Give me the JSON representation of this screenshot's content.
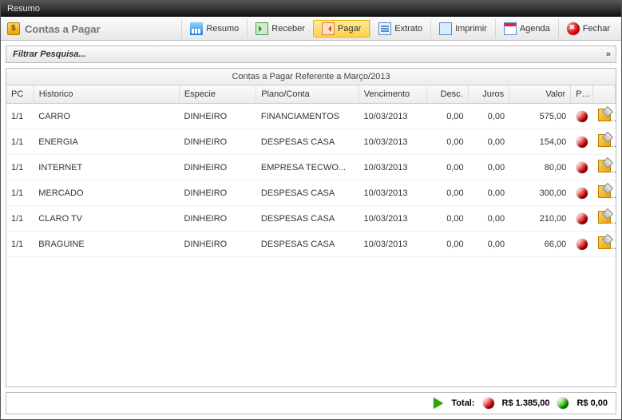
{
  "window": {
    "title": "Resumo"
  },
  "section": {
    "title": "Contas a Pagar"
  },
  "toolbar": {
    "resumo": "Resumo",
    "receber": "Receber",
    "pagar": "Pagar",
    "extrato": "Extrato",
    "imprimir": "Imprimir",
    "agenda": "Agenda",
    "fechar": "Fechar",
    "active": "pagar"
  },
  "filter": {
    "label": "Filtrar Pesquisa..."
  },
  "grid": {
    "title": "Contas a Pagar Referente a Março/2013",
    "headers": {
      "pc": "PC",
      "historico": "Historico",
      "especie": "Especie",
      "plano": "Plano/Conta",
      "vencimento": "Vencimento",
      "desc": "Desc.",
      "juros": "Juros",
      "valor": "Valor",
      "pg": "PG"
    },
    "rows": [
      {
        "pc": "1/1",
        "historico": "CARRO",
        "especie": "DINHEIRO",
        "plano": "FINANCIAMENTOS",
        "venc": "10/03/2013",
        "desc": "0,00",
        "juros": "0,00",
        "valor": "575,00",
        "pg": "red"
      },
      {
        "pc": "1/1",
        "historico": "ENERGIA",
        "especie": "DINHEIRO",
        "plano": "DESPESAS CASA",
        "venc": "10/03/2013",
        "desc": "0,00",
        "juros": "0,00",
        "valor": "154,00",
        "pg": "red"
      },
      {
        "pc": "1/1",
        "historico": "INTERNET",
        "especie": "DINHEIRO",
        "plano": "EMPRESA TECWO...",
        "venc": "10/03/2013",
        "desc": "0,00",
        "juros": "0,00",
        "valor": "80,00",
        "pg": "red"
      },
      {
        "pc": "1/1",
        "historico": "MERCADO",
        "especie": "DINHEIRO",
        "plano": "DESPESAS CASA",
        "venc": "10/03/2013",
        "desc": "0,00",
        "juros": "0,00",
        "valor": "300,00",
        "pg": "red"
      },
      {
        "pc": "1/1",
        "historico": "CLARO TV",
        "especie": "DINHEIRO",
        "plano": "DESPESAS CASA",
        "venc": "10/03/2013",
        "desc": "0,00",
        "juros": "0,00",
        "valor": "210,00",
        "pg": "red"
      },
      {
        "pc": "1/1",
        "historico": "BRAGUINE",
        "especie": "DINHEIRO",
        "plano": "DESPESAS CASA",
        "venc": "10/03/2013",
        "desc": "0,00",
        "juros": "0,00",
        "valor": "66,00",
        "pg": "red"
      }
    ]
  },
  "footer": {
    "total_label": "Total:",
    "unpaid": "R$ 1.385,00",
    "paid": "R$ 0,00"
  }
}
